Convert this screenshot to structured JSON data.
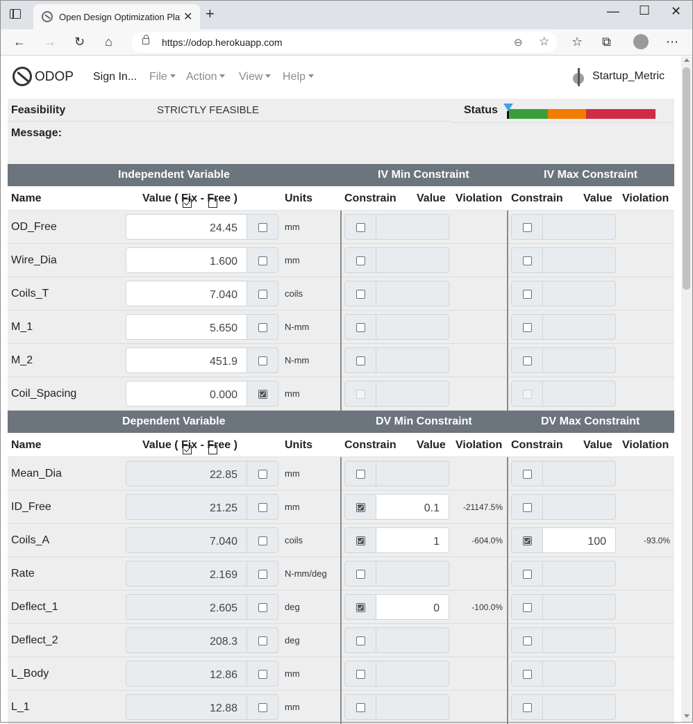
{
  "browser": {
    "tab_title": "Open Design Optimization Platfo",
    "url": "https://odop.herokuapp.com"
  },
  "app": {
    "brand": "ODOP",
    "menus": {
      "sign_in": "Sign In...",
      "file": "File",
      "action": "Action",
      "view": "View",
      "help": "Help"
    },
    "design_name": "Startup_Metric"
  },
  "feasibility": {
    "label": "Feasibility",
    "value": "STRICTLY FEASIBLE",
    "status_label": "Status",
    "message_label": "Message:",
    "status_colors": [
      "#3a9f3a",
      "#f07d00",
      "#d22b44"
    ],
    "marker_color": "#3da3e8"
  },
  "iv_table": {
    "title": "Independent Variable",
    "min_title": "IV Min Constraint",
    "max_title": "IV Max Constraint",
    "headers": {
      "name": "Name",
      "value_pre": "Value (",
      "fix": "Fix -",
      "free": "Free )",
      "units": "Units",
      "constrain": "Constrain",
      "value": "Value",
      "violation": "Violation"
    },
    "rows": [
      {
        "name": "OD_Free",
        "value": "24.45",
        "fixed": false,
        "units": "mm",
        "min_on": false,
        "min_val": "",
        "min_viol": "",
        "max_on": false,
        "max_val": "",
        "max_viol": ""
      },
      {
        "name": "Wire_Dia",
        "value": "1.600",
        "fixed": false,
        "units": "mm",
        "min_on": false,
        "min_val": "",
        "min_viol": "",
        "max_on": false,
        "max_val": "",
        "max_viol": ""
      },
      {
        "name": "Coils_T",
        "value": "7.040",
        "fixed": false,
        "units": "coils",
        "min_on": false,
        "min_val": "",
        "min_viol": "",
        "max_on": false,
        "max_val": "",
        "max_viol": ""
      },
      {
        "name": "M_1",
        "value": "5.650",
        "fixed": false,
        "units": "N-mm",
        "min_on": false,
        "min_val": "",
        "min_viol": "",
        "max_on": false,
        "max_val": "",
        "max_viol": ""
      },
      {
        "name": "M_2",
        "value": "451.9",
        "fixed": false,
        "units": "N-mm",
        "min_on": false,
        "min_val": "",
        "min_viol": "",
        "max_on": false,
        "max_val": "",
        "max_viol": ""
      },
      {
        "name": "Coil_Spacing",
        "value": "0.000",
        "fixed": true,
        "units": "mm",
        "min_on": false,
        "min_val": "",
        "min_viol": "",
        "max_on": false,
        "max_val": "",
        "max_viol": "",
        "disabled": true
      }
    ]
  },
  "dv_table": {
    "title": "Dependent Variable",
    "min_title": "DV Min Constraint",
    "max_title": "DV Max Constraint",
    "headers": {
      "name": "Name",
      "value_pre": "Value (",
      "fix": "Fix -",
      "free": "Free )",
      "units": "Units",
      "constrain": "Constrain",
      "value": "Value",
      "violation": "Violation"
    },
    "rows": [
      {
        "name": "Mean_Dia",
        "value": "22.85",
        "fixed": false,
        "units": "mm",
        "min_on": false,
        "min_val": "",
        "min_viol": "",
        "max_on": false,
        "max_val": "",
        "max_viol": ""
      },
      {
        "name": "ID_Free",
        "value": "21.25",
        "fixed": false,
        "units": "mm",
        "min_on": true,
        "min_val": "0.1",
        "min_viol": "-21147.5%",
        "max_on": false,
        "max_val": "",
        "max_viol": ""
      },
      {
        "name": "Coils_A",
        "value": "7.040",
        "fixed": false,
        "units": "coils",
        "min_on": true,
        "min_val": "1",
        "min_viol": "-604.0%",
        "max_on": true,
        "max_val": "100",
        "max_viol": "-93.0%"
      },
      {
        "name": "Rate",
        "value": "2.169",
        "fixed": false,
        "units": "N-mm/deg",
        "min_on": false,
        "min_val": "",
        "min_viol": "",
        "max_on": false,
        "max_val": "",
        "max_viol": ""
      },
      {
        "name": "Deflect_1",
        "value": "2.605",
        "fixed": false,
        "units": "deg",
        "min_on": true,
        "min_val": "0",
        "min_viol": "-100.0%",
        "max_on": false,
        "max_val": "",
        "max_viol": ""
      },
      {
        "name": "Deflect_2",
        "value": "208.3",
        "fixed": false,
        "units": "deg",
        "min_on": false,
        "min_val": "",
        "min_viol": "",
        "max_on": false,
        "max_val": "",
        "max_viol": ""
      },
      {
        "name": "L_Body",
        "value": "12.86",
        "fixed": false,
        "units": "mm",
        "min_on": false,
        "min_val": "",
        "min_viol": "",
        "max_on": false,
        "max_val": "",
        "max_viol": ""
      },
      {
        "name": "L_1",
        "value": "12.88",
        "fixed": false,
        "units": "mm",
        "min_on": false,
        "min_val": "",
        "min_viol": "",
        "max_on": false,
        "max_val": "",
        "max_viol": ""
      }
    ]
  }
}
